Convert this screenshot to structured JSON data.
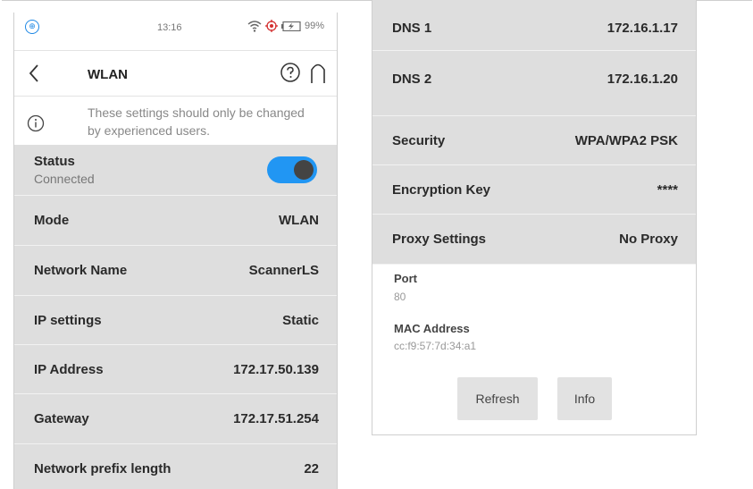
{
  "left": {
    "status_bar": {
      "time": "13:16",
      "battery": "99%"
    },
    "header": {
      "back_icon": "chevron-left-icon",
      "title": "WLAN",
      "help_icon": "help-circle-icon",
      "home_icon": "home-arch-icon"
    },
    "notice": {
      "icon": "info-circle-icon",
      "text": "These settings should only be changed by experienced users."
    },
    "status": {
      "label": "Status",
      "sub": "Connected",
      "enabled": true,
      "toggle_color": "#2196f3"
    },
    "rows": [
      {
        "label": "Mode",
        "value": "WLAN"
      },
      {
        "label": "Network Name",
        "value": "ScannerLS"
      },
      {
        "label": "IP settings",
        "value": "Static"
      },
      {
        "label": "IP Address",
        "value": "172.17.50.139"
      },
      {
        "label": "Gateway",
        "value": "172.17.51.254"
      },
      {
        "label": "Network prefix length",
        "value": "22"
      }
    ]
  },
  "right": {
    "rows": [
      {
        "label": "DNS 1",
        "value": "172.16.1.17"
      },
      {
        "label": "DNS 2",
        "value": "172.16.1.20"
      },
      {
        "label": "Security",
        "value": "WPA/WPA2 PSK"
      },
      {
        "label": "Encryption Key",
        "value": "****"
      },
      {
        "label": "Proxy Settings",
        "value": "No Proxy"
      }
    ],
    "port": {
      "label": "Port",
      "value": "80"
    },
    "mac": {
      "label": "MAC Address",
      "value": "cc:f9:57:7d:34:a1"
    },
    "buttons": {
      "refresh": "Refresh",
      "info": "Info"
    }
  },
  "colors": {
    "row_bg": "#dedede",
    "accent": "#2196f3"
  }
}
